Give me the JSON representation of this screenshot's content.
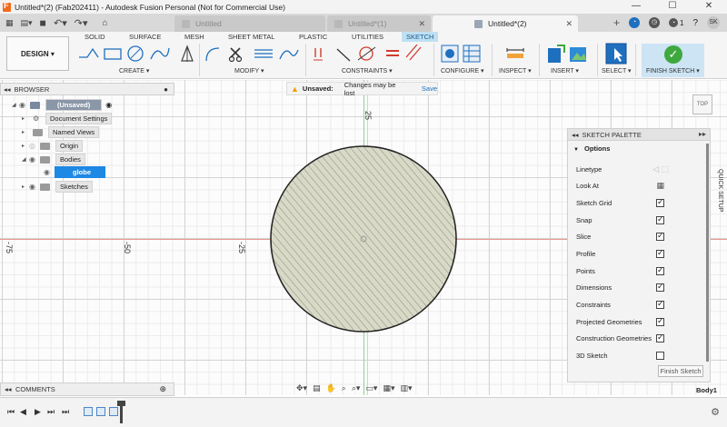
{
  "window": {
    "title": "Untitled*(2) (Fab202411) - Autodesk Fusion Personal (Not for Commercial Use)",
    "controls": [
      "—",
      "☐",
      "✕"
    ]
  },
  "tabs": [
    {
      "label": "Untitled",
      "active": false
    },
    {
      "label": "Untitled*(1)",
      "active": false
    },
    {
      "label": "Untitled*(2)",
      "active": true
    }
  ],
  "account": {
    "notifications": "1",
    "initials": "SK"
  },
  "ribbon": {
    "workspace": "DESIGN ▾",
    "tabs": [
      "SOLID",
      "SURFACE",
      "MESH",
      "SHEET METAL",
      "PLASTIC",
      "UTILITIES",
      "SKETCH"
    ],
    "active_tab": "SKETCH",
    "groups": [
      "CREATE ▾",
      "MODIFY ▾",
      "CONSTRAINTS ▾",
      "CONFIGURE ▾",
      "INSPECT ▾",
      "INSERT ▾",
      "SELECT ▾",
      "FINISH SKETCH ▾"
    ]
  },
  "browser": {
    "title": "BROWSER",
    "items": [
      {
        "label": "(Unsaved)"
      },
      {
        "label": "Document Settings"
      },
      {
        "label": "Named Views"
      },
      {
        "label": "Origin"
      },
      {
        "label": "Bodies"
      },
      {
        "label": "globe"
      },
      {
        "label": "Sketches"
      }
    ]
  },
  "unsaved_bar": {
    "label": "Unsaved:",
    "message": "Changes may be lost",
    "action": "Save"
  },
  "viewcube": {
    "label": "TOP"
  },
  "axis_labels": {
    "top": "25",
    "left1": "-75",
    "left2": "-50",
    "left3": "-25"
  },
  "palette": {
    "title": "SKETCH PALETTE",
    "section": "Options",
    "options": [
      {
        "label": "Linetype",
        "control": "linetype"
      },
      {
        "label": "Look At",
        "control": "lookat"
      },
      {
        "label": "Sketch Grid",
        "checked": true
      },
      {
        "label": "Snap",
        "checked": true
      },
      {
        "label": "Slice",
        "checked": true
      },
      {
        "label": "Profile",
        "checked": true
      },
      {
        "label": "Points",
        "checked": true
      },
      {
        "label": "Dimensions",
        "checked": true
      },
      {
        "label": "Constraints",
        "checked": true
      },
      {
        "label": "Projected Geometries",
        "checked": true
      },
      {
        "label": "Construction Geometries",
        "checked": true
      },
      {
        "label": "3D Sketch",
        "checked": false
      }
    ],
    "finish_button": "Finish Sketch"
  },
  "quick_setup": "QUICK SETUP",
  "comments": {
    "title": "COMMENTS"
  },
  "status": {
    "selection": "Body1"
  }
}
